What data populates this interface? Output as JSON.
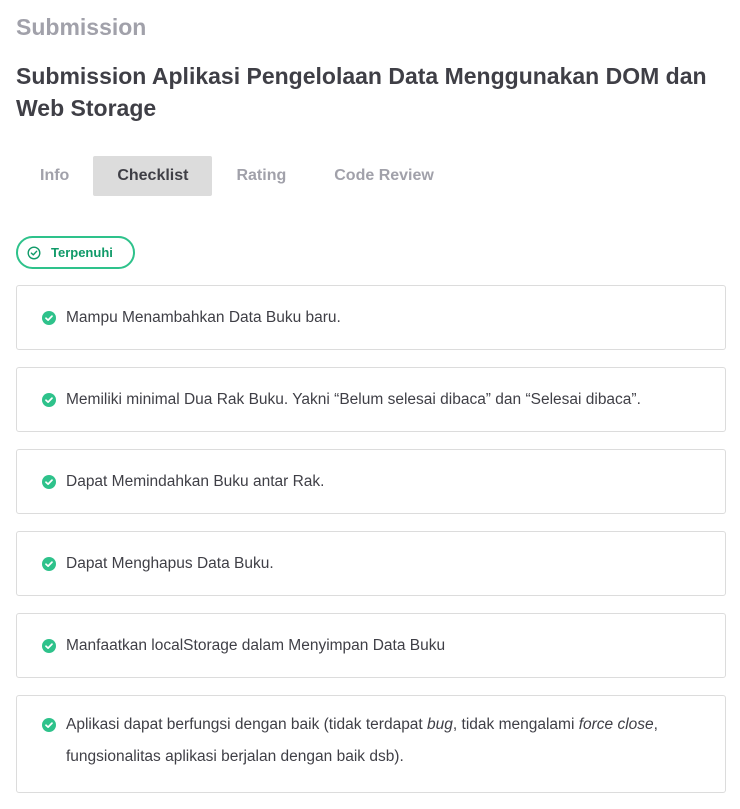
{
  "header": {
    "section_label": "Submission",
    "title": "Submission Aplikasi Pengelolaan Data Menggunakan DOM dan Web Storage"
  },
  "tabs": [
    {
      "label": "Info",
      "active": false
    },
    {
      "label": "Checklist",
      "active": true
    },
    {
      "label": "Rating",
      "active": false
    },
    {
      "label": "Code Review",
      "active": false
    }
  ],
  "status": {
    "label": "Terpenuhi",
    "icon": "check-circle-icon",
    "color": "#2ec28b"
  },
  "checklist": {
    "items": [
      {
        "text": "Mampu Menambahkan Data Buku baru.",
        "icon": "check-filled-icon"
      },
      {
        "text": "Memiliki minimal Dua Rak Buku. Yakni “Belum selesai dibaca” dan “Selesai dibaca”.",
        "icon": "check-filled-icon"
      },
      {
        "text": "Dapat Memindahkan Buku antar Rak.",
        "icon": "check-filled-icon"
      },
      {
        "text": "Dapat Menghapus Data Buku.",
        "icon": "check-filled-icon"
      },
      {
        "text": "Manfaatkan localStorage dalam Menyimpan Data Buku",
        "icon": "check-filled-icon"
      },
      {
        "text_part1": "Aplikasi dapat berfungsi dengan baik (tidak terdapat ",
        "text_em1": "bug",
        "text_part2": ", tidak mengalami ",
        "text_em2": "force close",
        "text_part3": ", fungsionalitas aplikasi berjalan dengan baik dsb).",
        "icon": "check-filled-icon"
      }
    ]
  },
  "colors": {
    "accent": "#2ec28b",
    "title": "#3f3f46",
    "muted": "#a1a1aa",
    "active_tab_bg": "#dcdcdc"
  }
}
